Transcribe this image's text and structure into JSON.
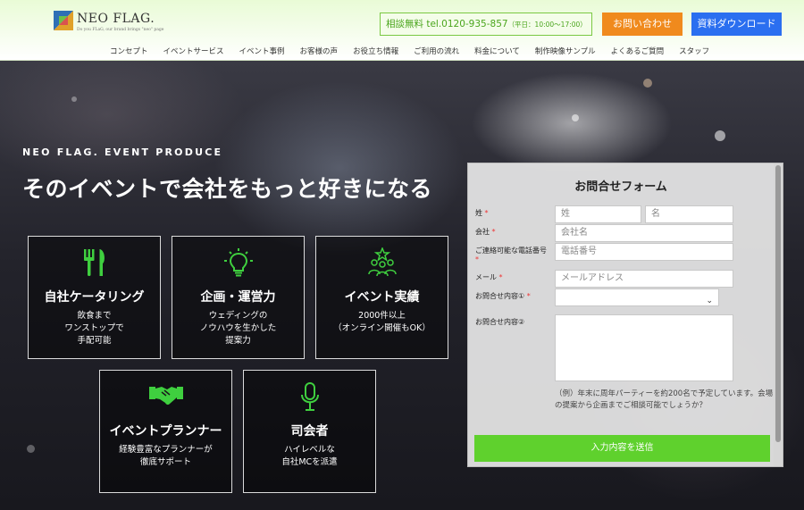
{
  "colors": {
    "accent_green": "#5fd12d",
    "contact_orange": "#f08a1d",
    "download_blue": "#2b6ff0",
    "icon_green": "#3fcf3f"
  },
  "header": {
    "logo_text": "NEO FLAG.",
    "logo_sub": "Do you FLaG, our brand brings \"neo\" page",
    "tel_label": "相談無料 tel.0120-935-857",
    "tel_hours": "（平日：10:00〜17:00）",
    "contact_button": "お問い合わせ",
    "download_button": "資料ダウンロード",
    "nav": [
      "コンセプト",
      "イベントサービス",
      "イベント事例",
      "お客様の声",
      "お役立ち情報",
      "ご利用の流れ",
      "料金について",
      "制作映像サンプル",
      "よくあるご質問",
      "スタッフ"
    ]
  },
  "hero": {
    "eyebrow": "NEO FLAG. EVENT PRODUCE",
    "headline": "そのイベントで会社をもっと好きになる"
  },
  "features": [
    {
      "icon": "fork-knife-icon",
      "title": "自社ケータリング",
      "desc": "飲食まで\nワンストップで\n手配可能"
    },
    {
      "icon": "lightbulb-icon",
      "title": "企画・運営力",
      "desc": "ウェディングの\nノウハウを生かした\n提案力"
    },
    {
      "icon": "team-star-icon",
      "title": "イベント実績",
      "desc": "2000件以上\n（オンライン開催もOK）"
    },
    {
      "icon": "handshake-icon",
      "title": "イベントプランナー",
      "desc": "経験豊富なプランナーが\n徹底サポート"
    },
    {
      "icon": "microphone-icon",
      "title": "司会者",
      "desc": "ハイレベルな\n自社MCを派遣"
    }
  ],
  "form": {
    "title": "お問合せフォーム",
    "last_name_label": "姓",
    "last_name_placeholder": "姓",
    "first_name_placeholder": "名",
    "company_label": "会社",
    "company_placeholder": "会社名",
    "phone_label": "ご連絡可能な電話番号",
    "phone_placeholder": "電話番号",
    "email_label": "メール",
    "email_placeholder": "メールアドレス",
    "inquiry1_label": "お問合せ内容①",
    "inquiry1_value": "",
    "inquiry2_label": "お問合せ内容②",
    "hint": "（例）年末に周年パーティーを約200名で予定しています。会場の提案から企画までご相談可能でしょうか？",
    "required_mark": "*",
    "submit": "入力内容を送信"
  }
}
